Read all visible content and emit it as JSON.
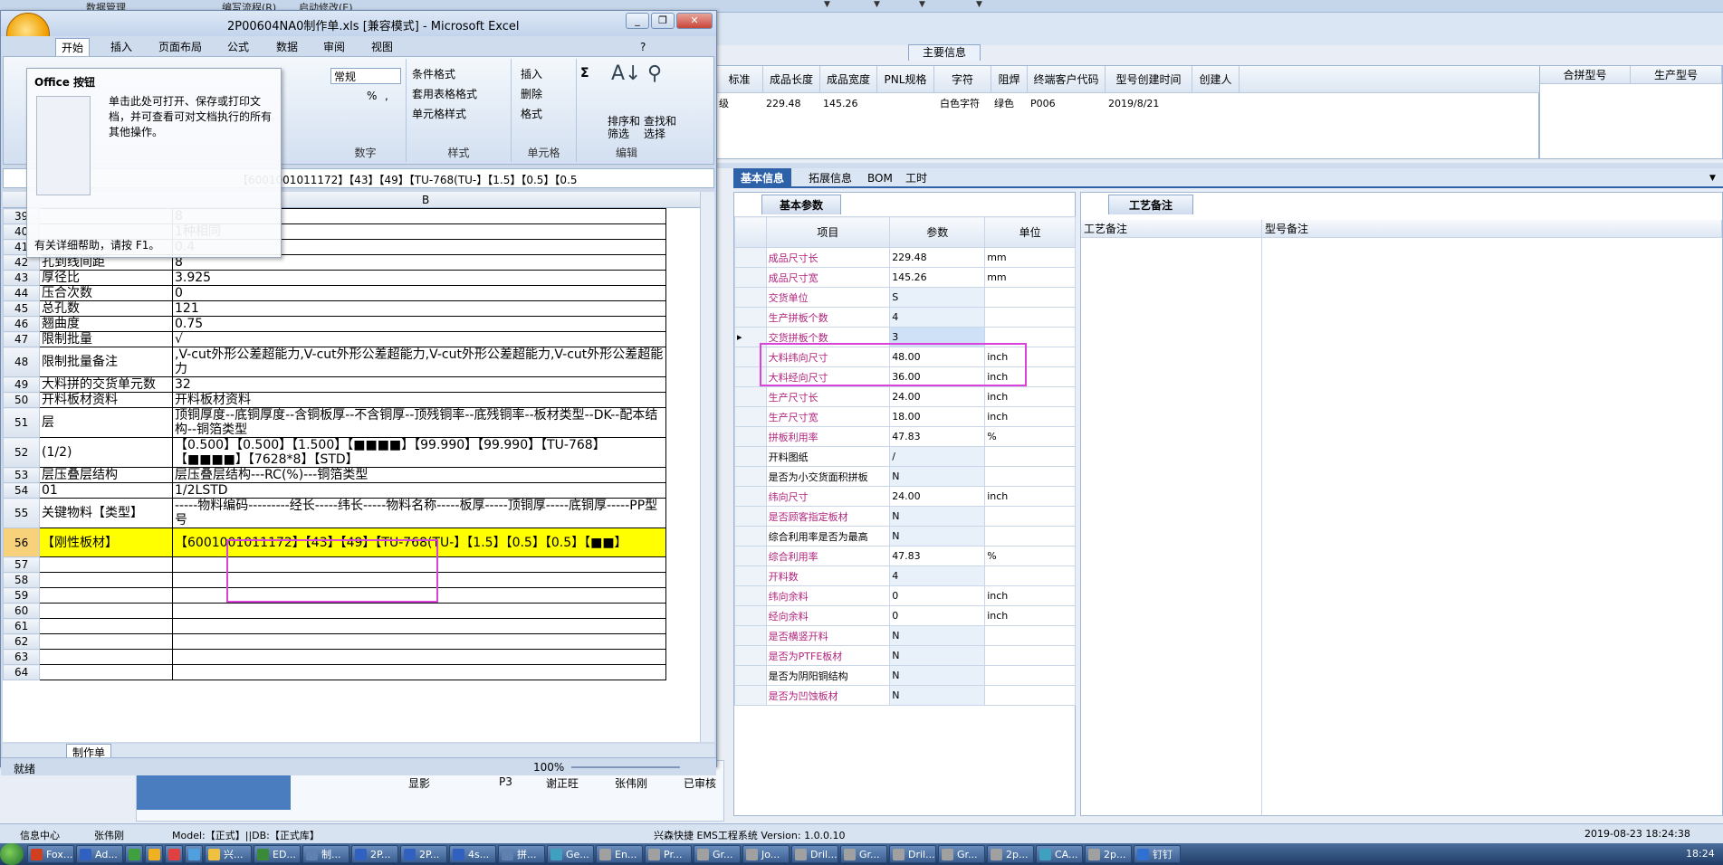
{
  "bg_app": {
    "top_menu": [
      "数据管理",
      "编写流程(R)",
      "启动修改(E)"
    ],
    "main_info_tab": "主要信息",
    "summary_headers": [
      "标准",
      "成品长度",
      "成品宽度",
      "PNL规格",
      "字符",
      "阻焊",
      "终端客户代码",
      "型号创建时间",
      "创建人"
    ],
    "summary_row": [
      "级",
      "229.48",
      "145.26",
      "",
      "白色字符",
      "绿色",
      "P006",
      "2019/8/21",
      ""
    ],
    "right_headers": [
      "合拼型号",
      "生产型号"
    ],
    "bottom_tabs": [
      "基本信息",
      "拓展信息",
      "BOM",
      "工时"
    ],
    "left_subtab": "基本参数",
    "right_subtab": "工艺备注",
    "param_headers": [
      "项目",
      "参数",
      "单位"
    ],
    "params": [
      {
        "item": "成品尺寸长",
        "value": "229.48",
        "unit": "mm",
        "mag": true
      },
      {
        "item": "成品尺寸宽",
        "value": "145.26",
        "unit": "mm",
        "mag": true
      },
      {
        "item": "交货单位",
        "value": "S",
        "unit": "",
        "mag": true
      },
      {
        "item": "生产拼板个数",
        "value": "4",
        "unit": "",
        "mag": true
      },
      {
        "item": "交货拼板个数",
        "value": "3",
        "unit": "",
        "mag": true
      },
      {
        "item": "大料纬向尺寸",
        "value": "48.00",
        "unit": "inch",
        "mag": true
      },
      {
        "item": "大料经向尺寸",
        "value": "36.00",
        "unit": "inch",
        "mag": true
      },
      {
        "item": "生产尺寸长",
        "value": "24.00",
        "unit": "inch",
        "mag": true
      },
      {
        "item": "生产尺寸宽",
        "value": "18.00",
        "unit": "inch",
        "mag": true
      },
      {
        "item": "拼板利用率",
        "value": "47.83",
        "unit": "%",
        "mag": true
      },
      {
        "item": "开料图纸",
        "value": "/",
        "unit": "",
        "mag": false
      },
      {
        "item": "是否为小交货面积拼板",
        "value": "N",
        "unit": "",
        "mag": false
      },
      {
        "item": "纬向尺寸",
        "value": "24.00",
        "unit": "inch",
        "mag": true
      },
      {
        "item": "是否顾客指定板材",
        "value": "N",
        "unit": "",
        "mag": true
      },
      {
        "item": "综合利用率是否为最高",
        "value": "N",
        "unit": "",
        "mag": false
      },
      {
        "item": "综合利用率",
        "value": "47.83",
        "unit": "%",
        "mag": true
      },
      {
        "item": "开料数",
        "value": "4",
        "unit": "",
        "mag": true
      },
      {
        "item": "纬向余料",
        "value": "0",
        "unit": "inch",
        "mag": true
      },
      {
        "item": "经向余料",
        "value": "0",
        "unit": "inch",
        "mag": true
      },
      {
        "item": "是否横竖开料",
        "value": "N",
        "unit": "",
        "mag": true
      },
      {
        "item": "是否为PTFE板材",
        "value": "N",
        "unit": "",
        "mag": true
      },
      {
        "item": "是否为阴阳铜结构",
        "value": "N",
        "unit": "",
        "mag": false
      },
      {
        "item": "是否为凹蚀板材",
        "value": "N",
        "unit": "",
        "mag": true
      }
    ],
    "remark_headers": [
      "工艺备注",
      "型号备注"
    ],
    "lower_row": [
      "显影",
      "P3",
      "谢正旺",
      "张伟刚",
      "已审核"
    ]
  },
  "statusbar": {
    "info_center": "信息中心",
    "user": "张伟刚",
    "model": "Model:【正式】||DB:【正式库】",
    "system": "兴森快捷 EMS工程系统 Version: 1.0.0.10",
    "datetime": "2019-08-23 18:24:38"
  },
  "taskbar": {
    "items": [
      "Fox...",
      "Ad...",
      "",
      "",
      "",
      "",
      "兴...",
      "ED...",
      "制...",
      "2P...",
      "2P...",
      "4s...",
      "拼...",
      "Ge...",
      "En...",
      "Pr...",
      "Gr...",
      "Jo...",
      "Dril...",
      "Gr...",
      "Dril...",
      "Gr...",
      "2p...",
      "CA...",
      "2p...",
      "钉钉"
    ],
    "clock": "18:24"
  },
  "excel": {
    "title": "2P00604NA0制作单.xls [兼容模式] - Microsoft Excel",
    "tabs": [
      "开始",
      "插入",
      "页面布局",
      "公式",
      "数据",
      "审阅",
      "视图"
    ],
    "ribbon": {
      "number_format": "常规",
      "pct": "%",
      "comma": ",",
      "cond_format": "条件格式",
      "table_format": "套用表格格式",
      "cell_style": "单元格样式",
      "insert": "插入",
      "delete": "删除",
      "format": "格式",
      "sort": "排序和\n筛选",
      "find": "查找和\n选择",
      "groups": [
        "数字",
        "样式",
        "单元格",
        "编辑"
      ]
    },
    "tooltip": {
      "title": "Office 按钮",
      "body": "单击此处可打开、保存或打印文档，并可查看可对文档执行的所有其他操作。",
      "help": "有关详细帮助，请按 F1。"
    },
    "formula": "【6001001011172】【43】【49】【TU-768(TU-】【1.5】【0.5】【0.5",
    "col_b": "B",
    "rows": [
      {
        "n": "39",
        "a": "",
        "b": "8"
      },
      {
        "n": "40",
        "a": "",
        "b": "1种相同"
      },
      {
        "n": "41",
        "a": "",
        "b": "0.4"
      },
      {
        "n": "42",
        "a": "孔到线间距",
        "b": "8"
      },
      {
        "n": "43",
        "a": "厚径比",
        "b": "3.925"
      },
      {
        "n": "44",
        "a": "压合次数",
        "b": "0"
      },
      {
        "n": "45",
        "a": "总孔数",
        "b": "121"
      },
      {
        "n": "46",
        "a": "翘曲度",
        "b": "0.75"
      },
      {
        "n": "47",
        "a": "限制批量",
        "b": "√"
      },
      {
        "n": "48",
        "a": "限制批量备注",
        "b": ",V-cut外形公差超能力,V-cut外形公差超能力,V-cut外形公差超能力,V-cut外形公差超能力"
      },
      {
        "n": "49",
        "a": "大料拼的交货单元数",
        "b": "32"
      },
      {
        "n": "50",
        "a": "开料板材资料",
        "b": "开料板材资料"
      },
      {
        "n": "51",
        "a": "层",
        "b": "顶铜厚度--底铜厚度--含铜板厚--不含铜厚--顶残铜率--底残铜率--板材类型--DK--配本结构--铜箔类型"
      },
      {
        "n": "52",
        "a": "(1/2)",
        "b": "【0.500】【0.500】【1.500】【■■■■】【99.990】【99.990】【TU-768】【■■■■】【7628*8】【STD】"
      },
      {
        "n": "53",
        "a": "层压叠层结构",
        "b": "层压叠层结构---RC(%)---铜箔类型"
      },
      {
        "n": "54",
        "a": "01",
        "b": "1/2LSTD"
      },
      {
        "n": "55",
        "a": "关键物料【类型】",
        "b": "-----物料编码---------经长-----纬长-----物料名称-----板厚-----顶铜厚-----底铜厚-----PP型号"
      },
      {
        "n": "56",
        "a": "【刚性板材】",
        "b": "【6001001011172】【43】【49】【TU-768(TU-】【1.5】【0.5】【0.5】【■■】"
      },
      {
        "n": "57",
        "a": "",
        "b": ""
      },
      {
        "n": "58",
        "a": "",
        "b": ""
      },
      {
        "n": "59",
        "a": "",
        "b": ""
      },
      {
        "n": "60",
        "a": "",
        "b": ""
      },
      {
        "n": "61",
        "a": "",
        "b": ""
      },
      {
        "n": "62",
        "a": "",
        "b": ""
      },
      {
        "n": "63",
        "a": "",
        "b": ""
      },
      {
        "n": "64",
        "a": "",
        "b": ""
      }
    ],
    "sheet_tab": "制作单",
    "status": "就绪",
    "zoom": "100%"
  }
}
